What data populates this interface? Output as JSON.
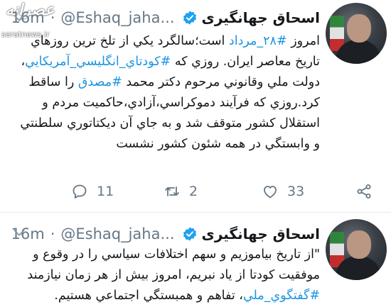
{
  "watermark": {
    "logo": "عصرانه",
    "site": "seratnews.ir"
  },
  "tweets": [
    {
      "display_name": "اسحاق جهانگيری",
      "handle": "@Eshaq_jaha...",
      "separator": "·",
      "time": "16m",
      "body": {
        "t1": "امروز ",
        "h1": "#۲۸_مرداد",
        "t2": " است؛سالگرد يكي از تلخ ترين روزهاي تاريخ معاصر ايران. روزي كه ",
        "h2": "#كودتاي_انگليسي_آمريكايي",
        "t3": "، دولت ملي وقانوني مرحوم دكتر محمد ",
        "h3": "#مصدق",
        "t4": " را ساقط كرد.روزي كه فرآيند دموكراسي،آزادي،حاكميت مردم و استقلال كشور متوقف شد و به جاي آن ديكتاتوري سلطنتي و وابستگي در همه شئون كشور نشست"
      },
      "actions": {
        "reply_count": "11",
        "retweet_count": "2",
        "like_count": "33"
      }
    },
    {
      "display_name": "اسحاق جهانگيری",
      "handle": "@Eshaq_jaha...",
      "separator": "·",
      "time": "16m",
      "body": {
        "t1": "\"از تاريخ بياموزيم و سهم اختلافات سياسي را در وقوع و موفقيت كودتا از ياد نبريم، امروز بيش از هر زمان نيازمند ",
        "h1": "#گفتگوي_ملي",
        "t2": "، تفاهم و همبستگي اجتماعي هستيم."
      }
    }
  ],
  "colors": {
    "link": "#1b95e0",
    "verified": "#1da1f2",
    "muted": "#657786"
  },
  "icons": [
    "chevron-down-icon",
    "verified-badge-icon",
    "reply-icon",
    "retweet-icon",
    "like-icon",
    "share-icon"
  ]
}
